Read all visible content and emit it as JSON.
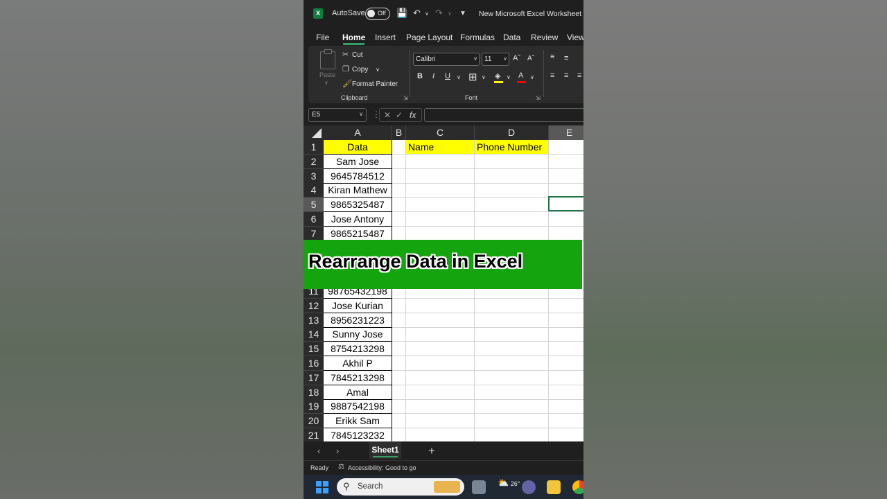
{
  "titlebar": {
    "app_icon": "excel-logo-icon",
    "autosave_label": "AutoSave",
    "toggle_state": "Off",
    "doc_title": "New Microsoft Excel Worksheet ∨"
  },
  "menu": {
    "tabs": [
      "File",
      "Home",
      "Insert",
      "Page Layout",
      "Formulas",
      "Data",
      "Review",
      "View"
    ],
    "active": "Home"
  },
  "ribbon": {
    "clipboard": {
      "paste_label": "Paste",
      "cut_label": "Cut",
      "copy_label": "Copy",
      "format_painter_label": "Format Painter",
      "group_label": "Clipboard"
    },
    "font": {
      "font_name": "Calibri",
      "font_size": "11",
      "group_label": "Font",
      "fill_color": "#ffff00",
      "font_color": "#ff0000"
    }
  },
  "formula_bar": {
    "name_box": "E5",
    "fx_label": "fx",
    "value": ""
  },
  "columns": [
    "A",
    "B",
    "C",
    "D",
    "E"
  ],
  "selected_column": "E",
  "selected_row": "5",
  "rows": [
    {
      "num": "1",
      "a": "Data",
      "c": "Name",
      "d": "Phone Number"
    },
    {
      "num": "2",
      "a": "Sam Jose"
    },
    {
      "num": "3",
      "a": "9645784512"
    },
    {
      "num": "4",
      "a": "Kiran Mathew"
    },
    {
      "num": "5",
      "a": "9865325487"
    },
    {
      "num": "6",
      "a": "Jose Antony"
    },
    {
      "num": "7",
      "a": "9865215487"
    },
    {
      "num": "11",
      "a": "98765432198"
    },
    {
      "num": "12",
      "a": "Jose Kurian"
    },
    {
      "num": "13",
      "a": "8956231223"
    },
    {
      "num": "14",
      "a": "Sunny Jose"
    },
    {
      "num": "15",
      "a": "8754213298"
    },
    {
      "num": "16",
      "a": "Akhil P"
    },
    {
      "num": "17",
      "a": "7845213298"
    },
    {
      "num": "18",
      "a": "Amal"
    },
    {
      "num": "19",
      "a": "9887542198"
    },
    {
      "num": "20",
      "a": "Erikk Sam"
    },
    {
      "num": "21",
      "a": "7845123232"
    }
  ],
  "banner": {
    "text": "Rearrange Data in Excel",
    "color": "#14a40e"
  },
  "sheets": {
    "tabs": [
      "Sheet1"
    ],
    "add_label": "+"
  },
  "status": {
    "ready": "Ready",
    "accessibility": "Accessibility: Good to go"
  },
  "taskbar": {
    "search_label": "Search",
    "weather_temp": "26°"
  },
  "colors": {
    "accent_green": "#217346",
    "header_yellow": "#ffff00",
    "tab_underline": "#36a166"
  }
}
